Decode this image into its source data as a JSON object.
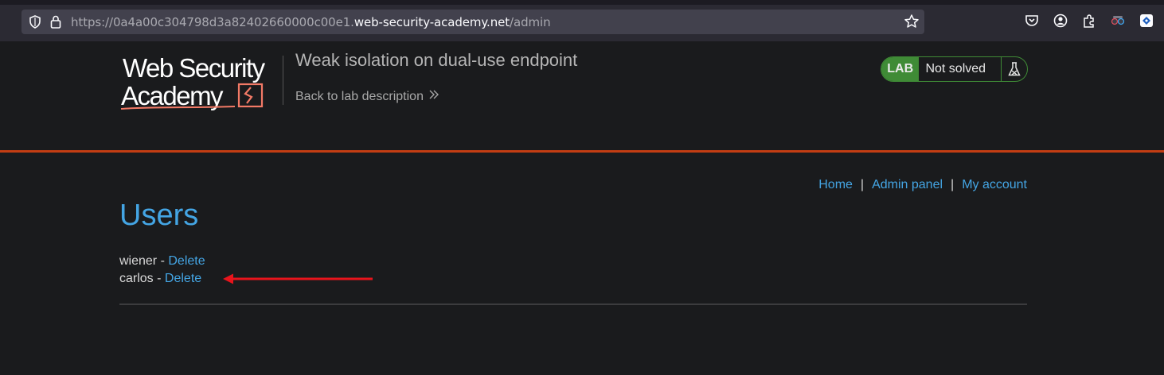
{
  "browser": {
    "url_prefix": "https://0a4a00c304798d3a82402660000c00e1.",
    "url_domain": "web-security-academy.net",
    "url_path": "/admin"
  },
  "header": {
    "logo_text": "Web Security Academy",
    "lab_title": "Weak isolation on dual-use endpoint",
    "back_link": "Back to lab description",
    "lab_badge": "LAB",
    "lab_status": "Not solved"
  },
  "nav": {
    "items": [
      {
        "label": "Home"
      },
      {
        "label": "Admin panel"
      },
      {
        "label": "My account"
      }
    ],
    "separator": "|"
  },
  "main": {
    "title": "Users",
    "users": [
      {
        "name": "wiener",
        "separator": " - ",
        "action": "Delete"
      },
      {
        "name": "carlos",
        "separator": " - ",
        "action": "Delete"
      }
    ]
  },
  "colors": {
    "accent_link": "#44a5e4",
    "header_rule": "#c33d13",
    "lab_green": "#3f8b36",
    "annotation_red": "#e8141c",
    "background": "#1a1b1d"
  },
  "icons": [
    "shield-icon",
    "lock-icon",
    "star-icon",
    "pocket-icon",
    "account-icon",
    "extensions-icon",
    "mask-icon",
    "extension-icon",
    "flask-icon",
    "chevron-right-icon",
    "arrow-icon"
  ]
}
